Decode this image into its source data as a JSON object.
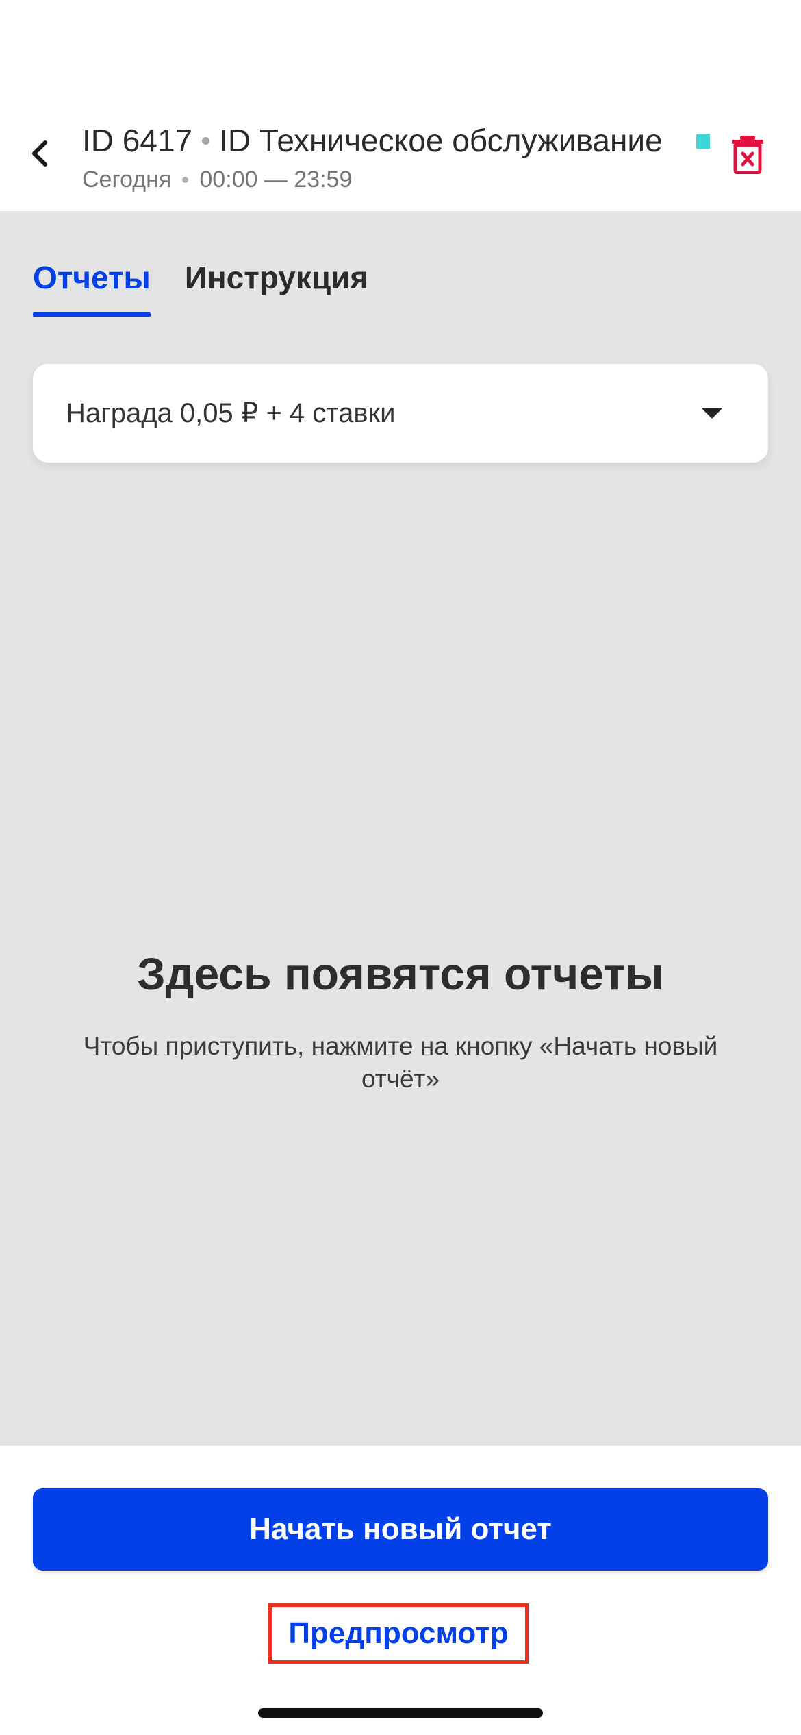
{
  "header": {
    "task_id": "ID 6417",
    "task_title": "ID Техническое обслуживание",
    "date_label": "Сегодня",
    "time_range": "00:00 — 23:59",
    "status_color": "#3fd6d8",
    "back_icon": "chevron-left-icon",
    "delete_icon": "trash-icon"
  },
  "tabs": [
    {
      "label": "Отчеты",
      "active": true
    },
    {
      "label": "Инструкция",
      "active": false
    }
  ],
  "reward": {
    "text": "Награда 0,05 ₽ + 4 ставки",
    "icon": "chevron-down-icon"
  },
  "empty_state": {
    "title": "Здесь появятся отчеты",
    "description": "Чтобы приступить, нажмите на кнопку «Начать новый отчёт»"
  },
  "actions": {
    "start_label": "Начать новый отчет",
    "preview_label": "Предпросмотр"
  },
  "colors": {
    "accent": "#0340e8",
    "danger": "#e0103f",
    "highlight": "#e8321c",
    "background": "#e4e4e4"
  }
}
